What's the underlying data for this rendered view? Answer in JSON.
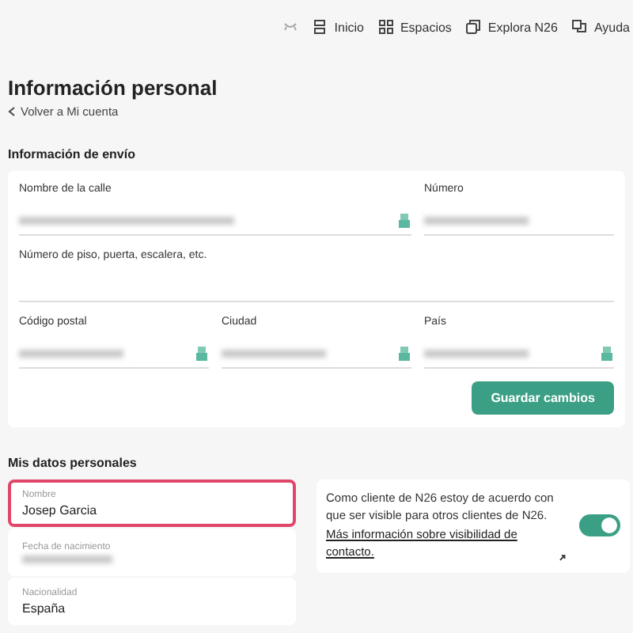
{
  "nav": [
    "Inicio",
    "Espacios",
    "Explora N26",
    "Ayuda"
  ],
  "title": "Información personal",
  "back_link": "Volver a Mi cuenta",
  "shipping": {
    "heading": "Información de envío",
    "fields": [
      {
        "label": "Nombre de la calle",
        "kind": "autofill"
      },
      {
        "label": "Número",
        "kind": "hidden"
      },
      {
        "label": "Número de piso, puerta, escalera, etc.",
        "kind": "empty"
      },
      {
        "label": "Código postal",
        "kind": "autofill"
      },
      {
        "label": "Ciudad",
        "kind": "autofill"
      },
      {
        "label": "País",
        "kind": "autofill"
      }
    ],
    "button": "Guardar cambios"
  },
  "personal": {
    "heading": "Mis datos personales",
    "fields": [
      {
        "label": "Nombre",
        "value": "Josep Garcia",
        "focused": true
      },
      {
        "label": "Fecha de nacimiento",
        "kind": "hidden",
        "focused": false
      },
      {
        "label": "Nacionalidad",
        "value": "España",
        "focused": false
      }
    ],
    "visibility": {
      "text": "Como cliente de N26 estoy de acuerdo con que ser visible para otros clientes de N26.",
      "link": "Más información sobre visibilidad de contacto.",
      "on": true
    }
  }
}
